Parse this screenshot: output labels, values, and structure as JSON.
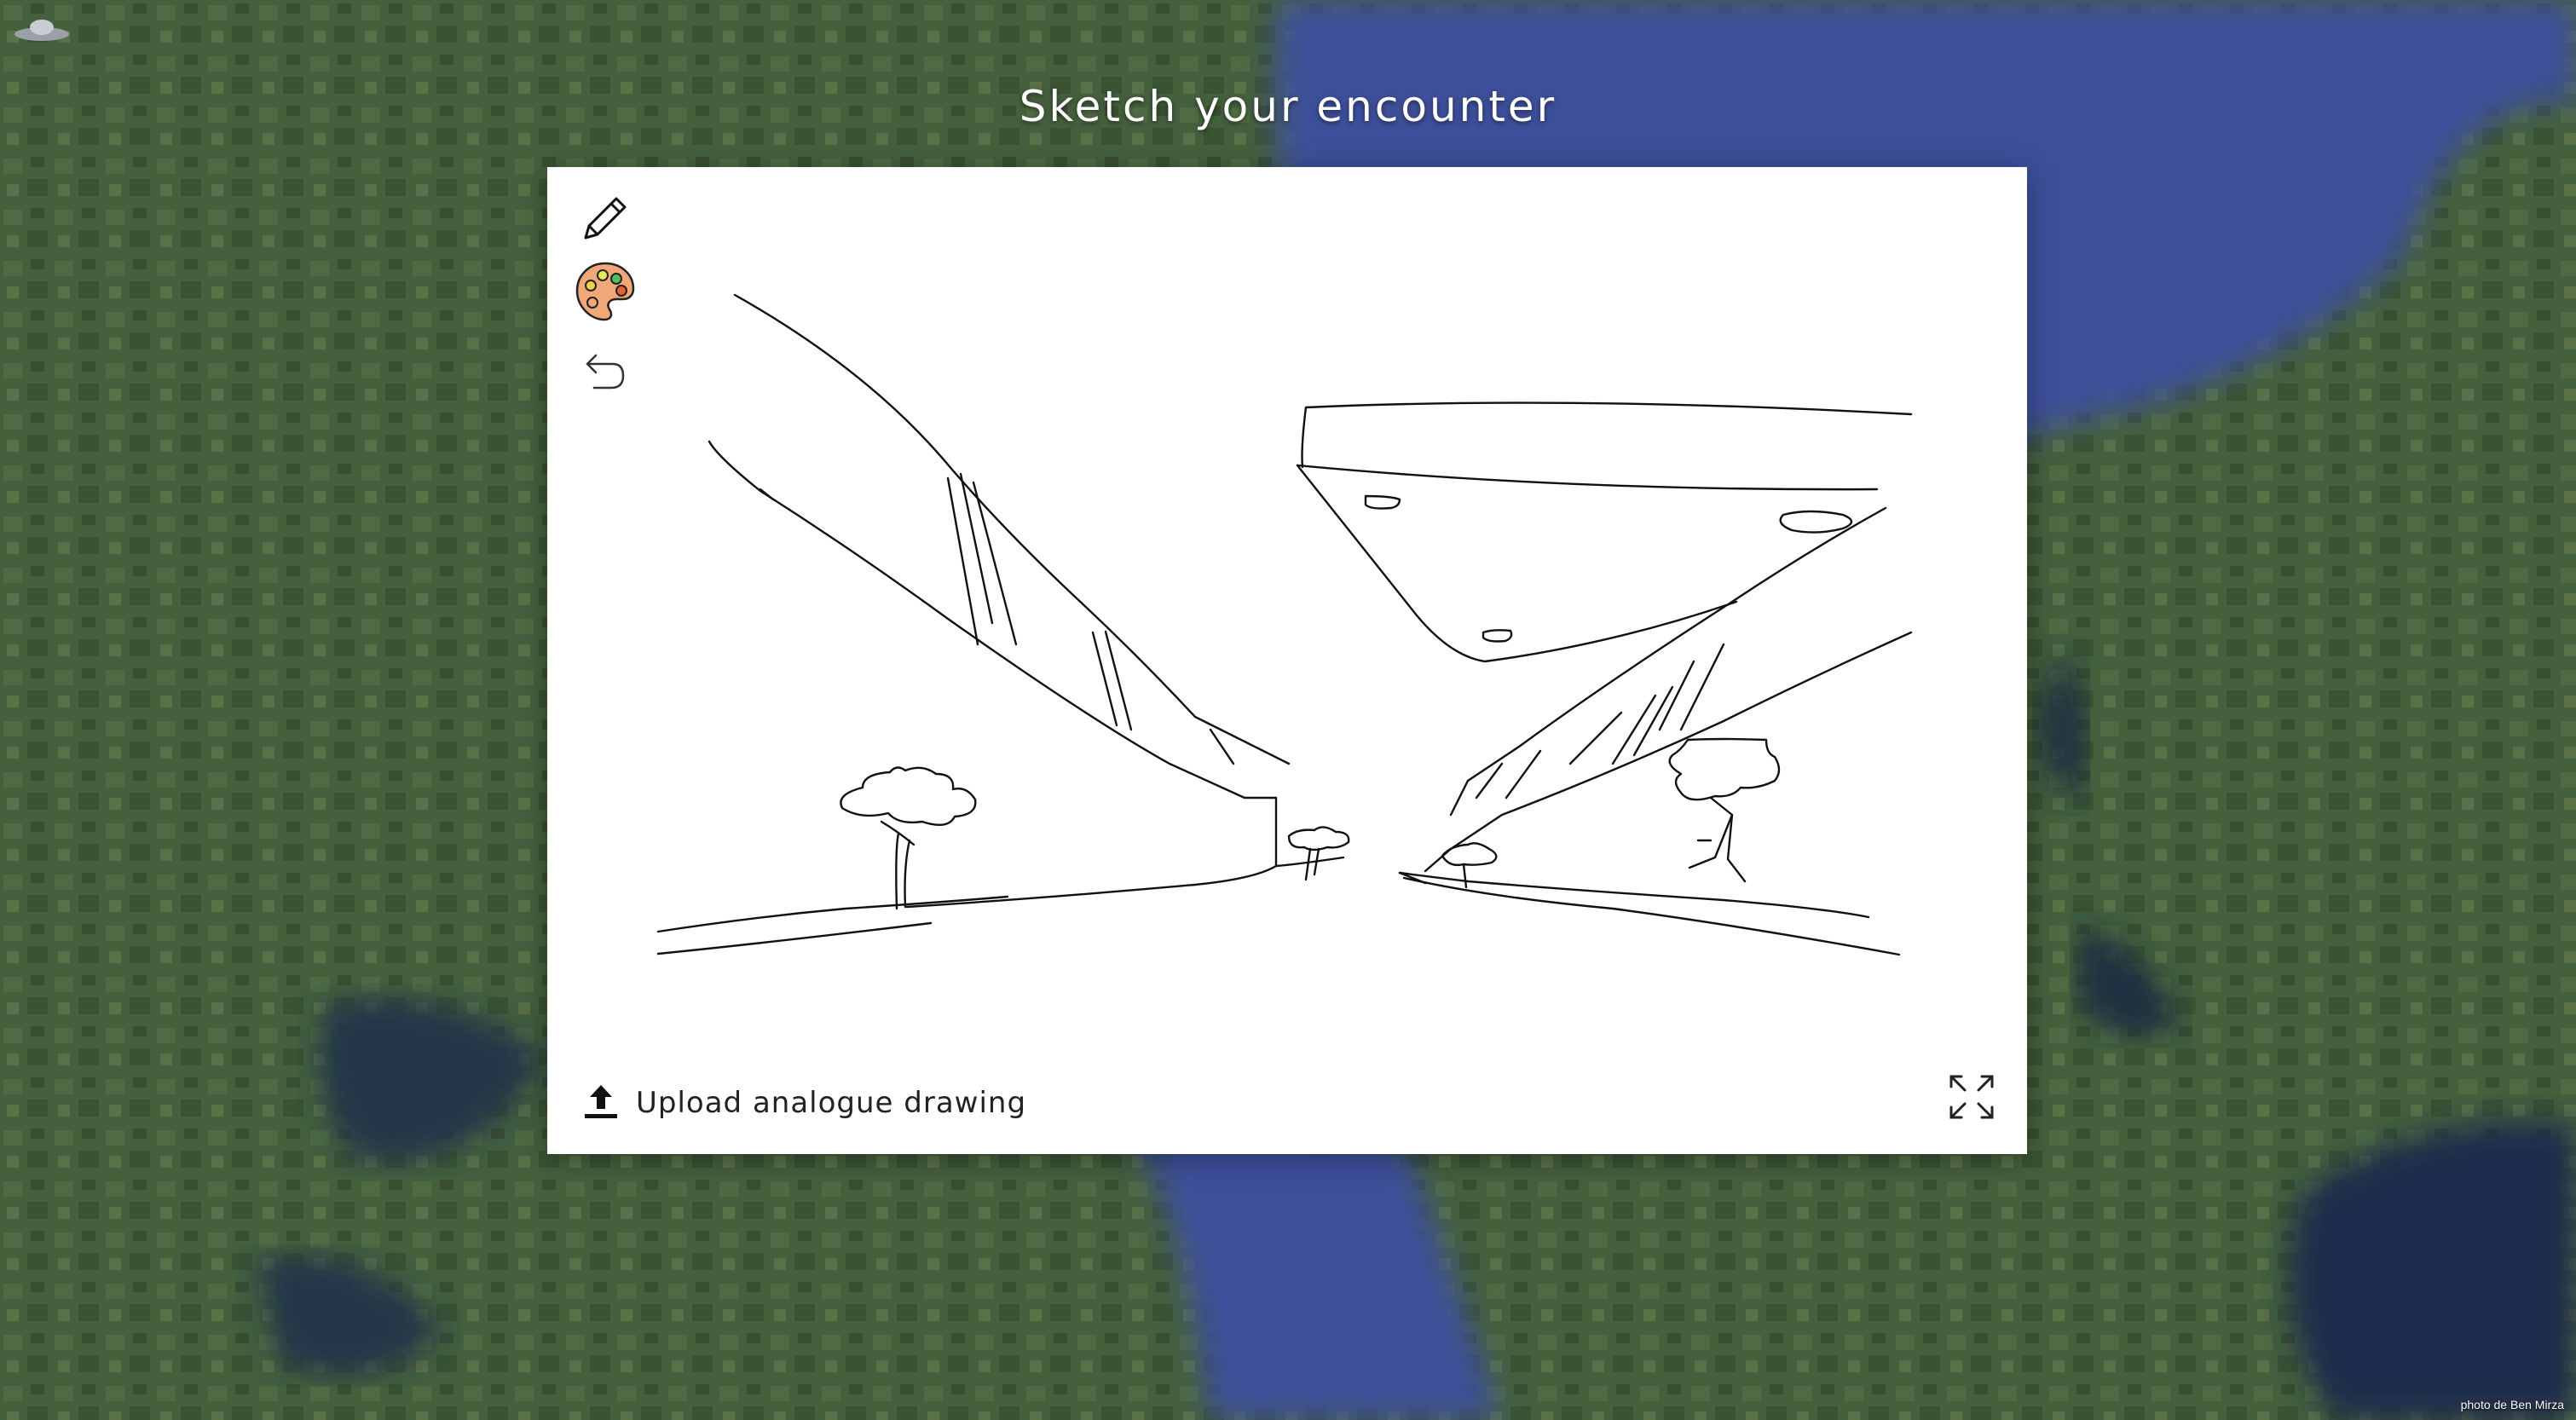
{
  "page": {
    "title": "Sketch your encounter",
    "credit": "photo de Ben Mirza"
  },
  "toolbar": {
    "pencil_icon": "pencil-icon",
    "palette_icon": "palette-icon",
    "undo_icon": "undo-icon"
  },
  "upload": {
    "label": "Upload analogue drawing",
    "icon": "upload-icon"
  },
  "expand": {
    "icon": "expand-icon"
  },
  "colors": {
    "water": "#3d4f9a",
    "land": "#3f5a3a",
    "panel": "#ffffff",
    "ink": "#111111",
    "palette": "#f0a878"
  }
}
